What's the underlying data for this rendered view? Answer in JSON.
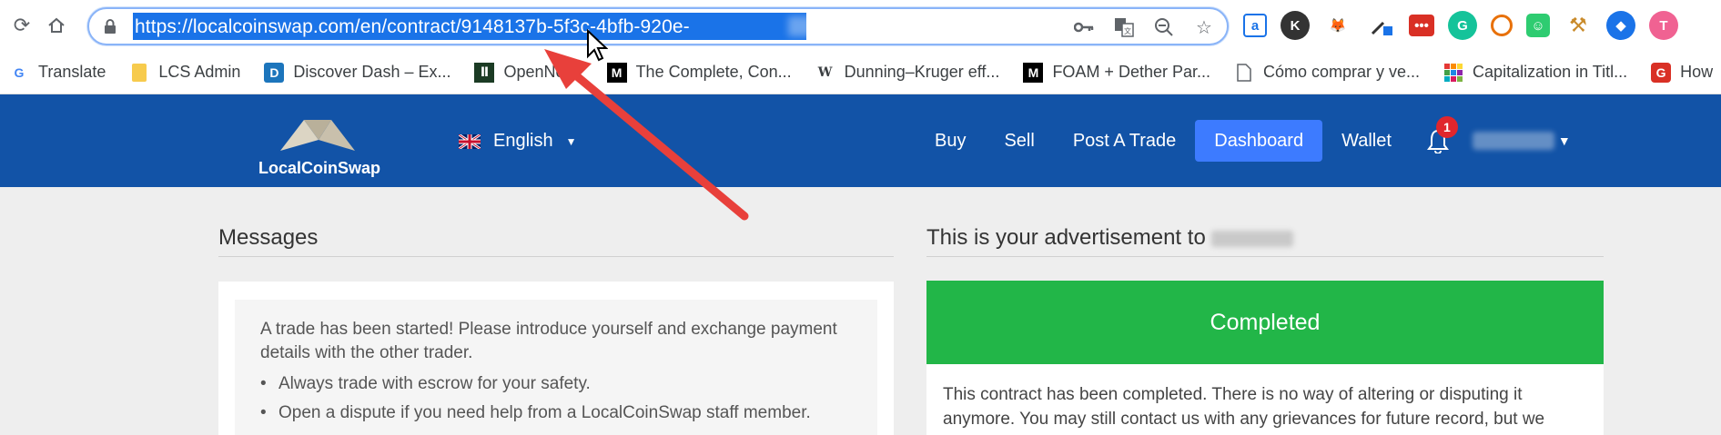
{
  "browser": {
    "url": "https://localcoinswap.com/en/contract/9148137b-5f3c-4bfb-920e-",
    "bookmarks": [
      {
        "label": "Translate",
        "icon": "google-icon"
      },
      {
        "label": "LCS Admin",
        "icon": "folder-icon"
      },
      {
        "label": "Discover Dash – Ex...",
        "icon": "dash-icon"
      },
      {
        "label": "OpenNode",
        "icon": "opennode-icon"
      },
      {
        "label": "The Complete, Con...",
        "icon": "medium-icon"
      },
      {
        "label": "Dunning–Kruger eff...",
        "icon": "wikipedia-icon"
      },
      {
        "label": "FOAM + Dether Par...",
        "icon": "medium-icon"
      },
      {
        "label": "Cómo comprar y ve...",
        "icon": "document-icon"
      },
      {
        "label": "Capitalization in Titl...",
        "icon": "grid-icon"
      },
      {
        "label": "How",
        "icon": "red-g-icon"
      }
    ]
  },
  "site": {
    "logo_text": "LocalCoinSwap",
    "language": "English",
    "nav": [
      {
        "label": "Buy"
      },
      {
        "label": "Sell"
      },
      {
        "label": "Post A Trade"
      },
      {
        "label": "Dashboard"
      },
      {
        "label": "Wallet"
      }
    ],
    "notification_count": "1",
    "colors": {
      "header": "#1253a7",
      "active": "#3d7bff",
      "success": "#22b648"
    }
  },
  "messages": {
    "title": "Messages",
    "intro": "A trade has been started! Please introduce yourself and exchange payment details with the other trader.",
    "tips": [
      "Always trade with escrow for your safety.",
      "Open a dispute if you need help from a LocalCoinSwap staff member."
    ]
  },
  "advert": {
    "title": "This is your advertisement to",
    "status": "Completed",
    "body": "This contract has been completed. There is no way of altering or disputing it anymore. You may still contact us with any grievances for future record, but we"
  }
}
